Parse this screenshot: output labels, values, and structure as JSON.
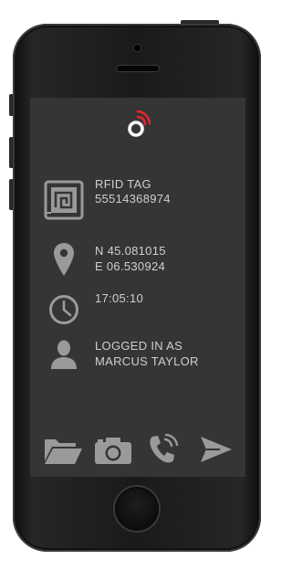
{
  "app": {
    "accent_color": "#e3262e",
    "screen_bg": "#353535",
    "text_color": "#cfcfcf",
    "icon_color": "#9a9a9a"
  },
  "rfid": {
    "icon": "rfid-chip-icon",
    "title": "RFID TAG",
    "value": "55514368974"
  },
  "location": {
    "icon": "location-pin-icon",
    "lat": "N 45.081015",
    "lon": "E 06.530924"
  },
  "time": {
    "icon": "clock-icon",
    "value": "17:05:10"
  },
  "user": {
    "icon": "user-icon",
    "line1": "LOGGED IN AS",
    "line2": "MARCUS TAYLOR"
  },
  "toolbar": {
    "items": [
      "folder-icon",
      "camera-icon",
      "phone-icon",
      "send-icon"
    ]
  }
}
